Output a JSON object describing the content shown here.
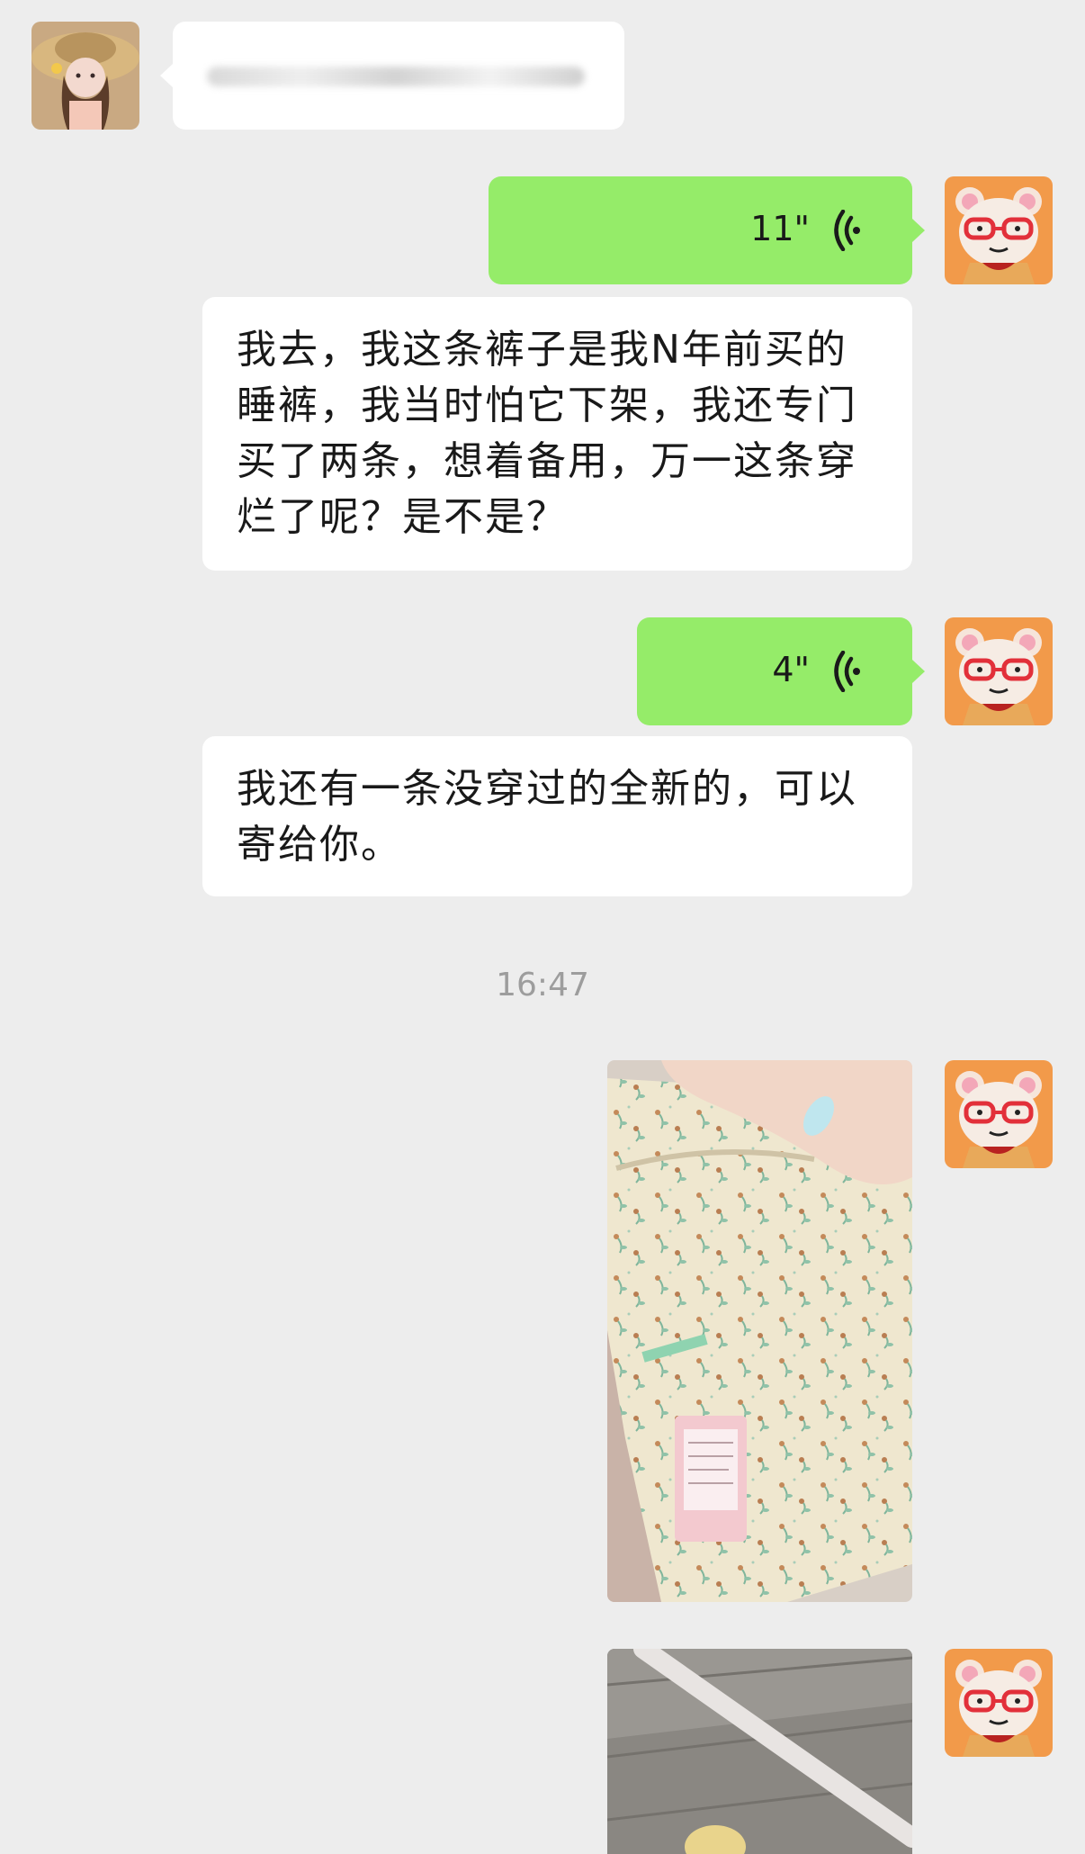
{
  "chat": {
    "messages": [
      {
        "id": "m1",
        "side": "left",
        "type": "text",
        "text": ""
      },
      {
        "id": "m2",
        "side": "right",
        "type": "voice",
        "duration": "11\""
      },
      {
        "id": "m3",
        "side": "left",
        "type": "text",
        "lines": [
          "我去，我这条裤子是我N年前买的",
          "睡裤，我当时怕它下架，我还专门",
          "买了两条，想着备用，万一这条穿",
          "烂了呢？是不是？"
        ]
      },
      {
        "id": "m4",
        "side": "right",
        "type": "voice",
        "duration": "4\""
      },
      {
        "id": "m5",
        "side": "left",
        "type": "text",
        "lines": [
          "我还有一条没穿过的全新的，可以",
          "寄给你。"
        ]
      },
      {
        "id": "m6",
        "side": "right",
        "type": "image",
        "label": "floral pajama pants photo"
      },
      {
        "id": "m7",
        "side": "right",
        "type": "image",
        "label": "floor photo"
      }
    ],
    "timestamp": "16:47"
  },
  "colors": {
    "background": "#ededed",
    "bubble_self": "#95ec69",
    "bubble_other": "#ffffff",
    "voice_icon": "#1a1a1a"
  },
  "icons": {
    "voice": "voice-wave-icon"
  }
}
